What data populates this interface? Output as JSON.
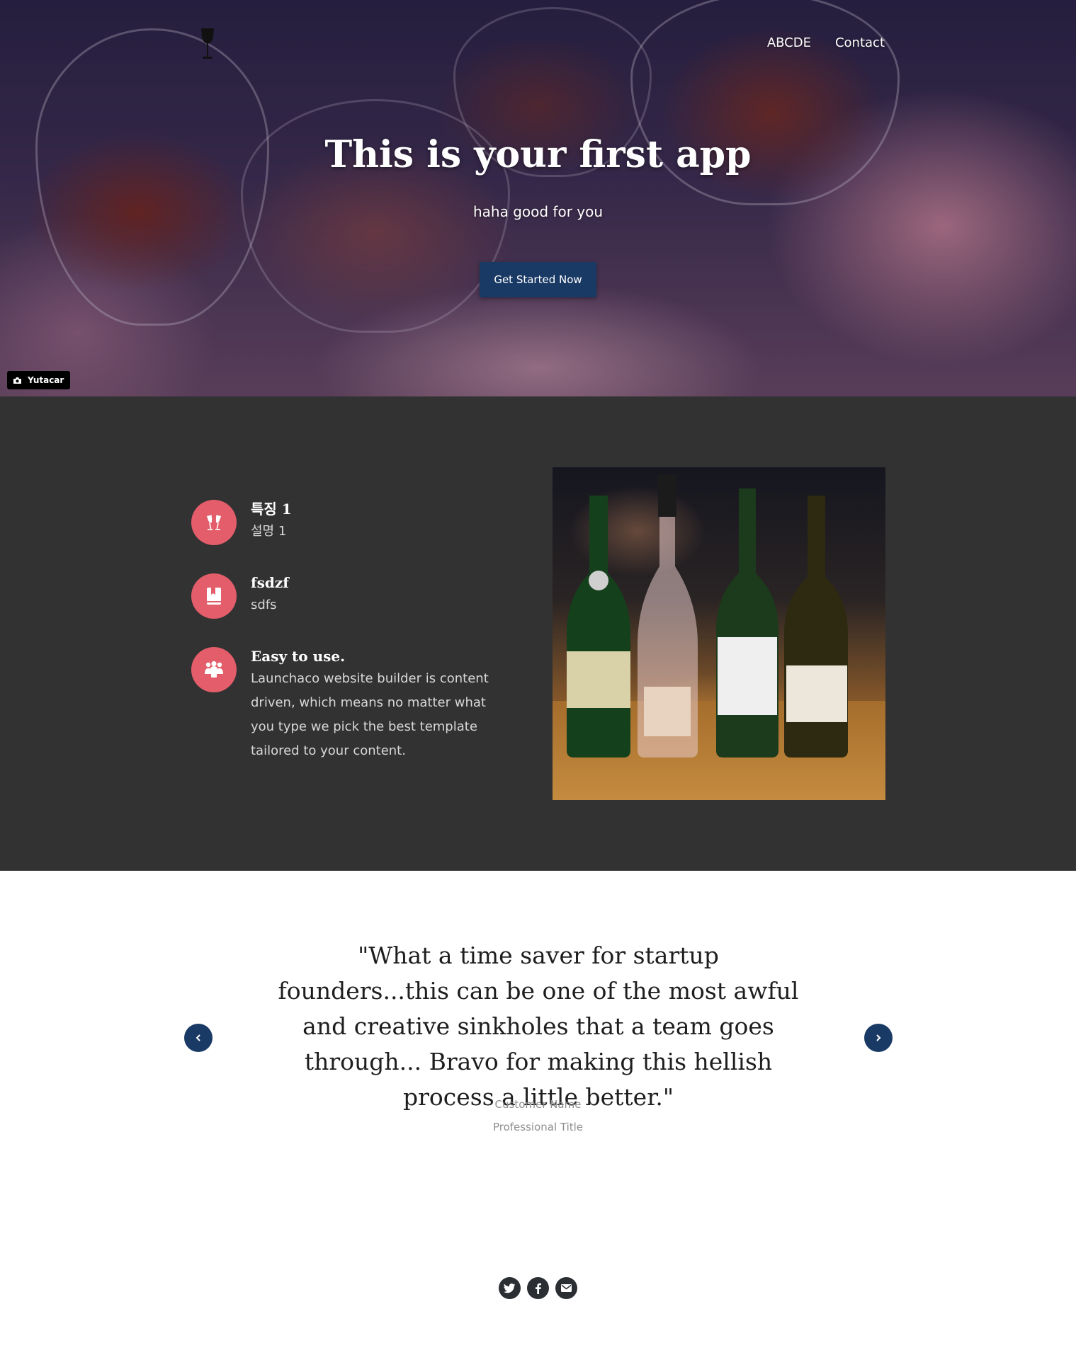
{
  "hero": {
    "nav": [
      {
        "label": "ABCDE"
      },
      {
        "label": "Contact"
      }
    ],
    "title": "This is your first app",
    "subtitle": "haha good for you",
    "cta_label": "Get Started Now",
    "photo_credit": "Yutacar"
  },
  "features": {
    "items": [
      {
        "icon": "wine-toast-icon",
        "title": "특징 1",
        "description": "설명 1"
      },
      {
        "icon": "book-icon",
        "title": "fsdzf",
        "description": "sdfs"
      },
      {
        "icon": "people-group-icon",
        "title": "Easy to use.",
        "description": "Launchaco website builder is content driven, which means no matter what you type we pick the best template tailored to your content."
      }
    ],
    "image": "wine-bottles-photo"
  },
  "testimonial": {
    "quote": "\"What a time saver for startup founders...this can be one of the most awful and creative sinkholes that a team goes through... Bravo for making this hellish process a little better.\"",
    "customer_name": "Customer Name",
    "customer_title": "Professional Title"
  },
  "social": [
    "twitter-icon",
    "facebook-icon",
    "email-icon"
  ],
  "colors": {
    "accent": "#1a3a66",
    "feature_icon_bg": "#e35d6a",
    "feature_section_bg": "#323232",
    "social_bg": "#2b2e33"
  }
}
